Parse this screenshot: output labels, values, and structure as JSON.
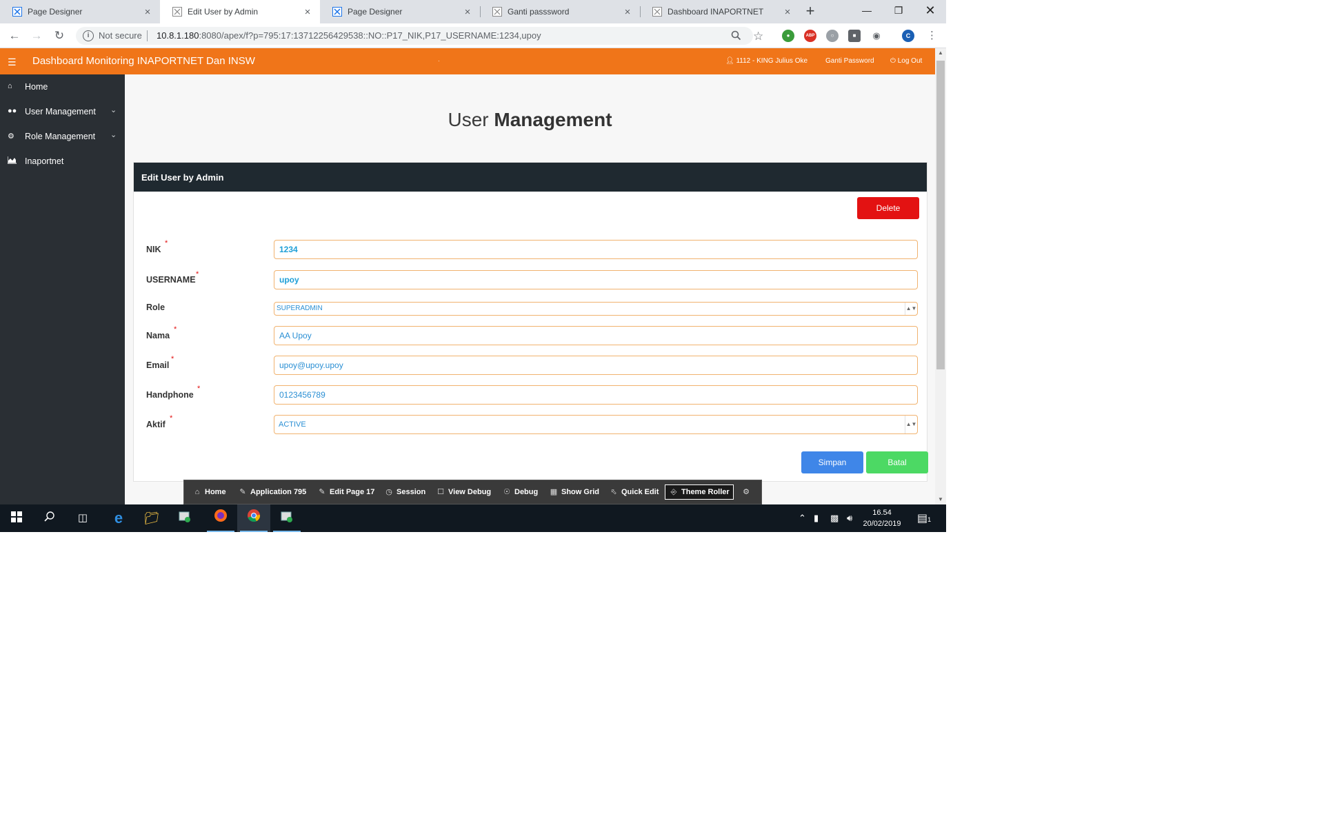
{
  "browser": {
    "tabs": [
      {
        "title": "Page Designer",
        "active": false
      },
      {
        "title": "Edit User by Admin",
        "active": true
      },
      {
        "title": "Page Designer",
        "active": false
      },
      {
        "title": "Ganti passsword",
        "active": false
      },
      {
        "title": "Dashboard INAPORTNET",
        "active": false
      }
    ],
    "security_label": "Not secure",
    "url_host": "10.8.1.180",
    "url_rest": ":8080/apex/f?p=795:17:13712256429538::NO::P17_NIK,P17_USERNAME:1234,upoy",
    "extension_c_label": "C",
    "extension_red_label": "ABP"
  },
  "header": {
    "app_title": "Dashboard Monitoring INAPORTNET Dan INSW",
    "dot": "·",
    "user": "1112 - KING Julius Oke",
    "change_password": "Ganti Password",
    "logout": "Log Out"
  },
  "sidebar": {
    "items": [
      {
        "label": "Home",
        "icon": "home-icon",
        "has_children": false
      },
      {
        "label": "User Management",
        "icon": "users-icon",
        "has_children": true
      },
      {
        "label": "Role Management",
        "icon": "cogs-icon",
        "has_children": true
      },
      {
        "label": "Inaportnet",
        "icon": "area-chart-icon",
        "has_children": false
      }
    ]
  },
  "page": {
    "title_light": "User ",
    "title_bold": "Management",
    "region_title": "Edit User by Admin",
    "delete_label": "Delete",
    "save_label": "Simpan",
    "cancel_label": "Batal"
  },
  "form": {
    "nik": {
      "label": "NIK",
      "value": "1234",
      "required": true
    },
    "username": {
      "label": "USERNAME",
      "value": "upoy",
      "required": true
    },
    "role": {
      "label": "Role",
      "value": "SUPERADMIN",
      "required": false
    },
    "nama": {
      "label": "Nama",
      "value": "AA Upoy",
      "required": true
    },
    "email": {
      "label": "Email",
      "value": "upoy@upoy.upoy",
      "required": true
    },
    "handphone": {
      "label": "Handphone",
      "value": "0123456789",
      "required": true
    },
    "aktif": {
      "label": "Aktif",
      "value": "ACTIVE",
      "required": true
    }
  },
  "devbar": {
    "items": [
      "Home",
      "Application 795",
      "Edit Page 17",
      "Session",
      "View Debug",
      "Debug",
      "Show Grid",
      "Quick Edit",
      "Theme Roller"
    ]
  },
  "taskbar": {
    "time": "16.54",
    "date": "20/02/2019",
    "notification_count": "1"
  },
  "colors": {
    "header": "#f07519",
    "sidebar": "#2a2f34",
    "region_header": "#1f2930",
    "delete": "#e31212",
    "save": "#3f86e8",
    "cancel": "#4cd964"
  }
}
